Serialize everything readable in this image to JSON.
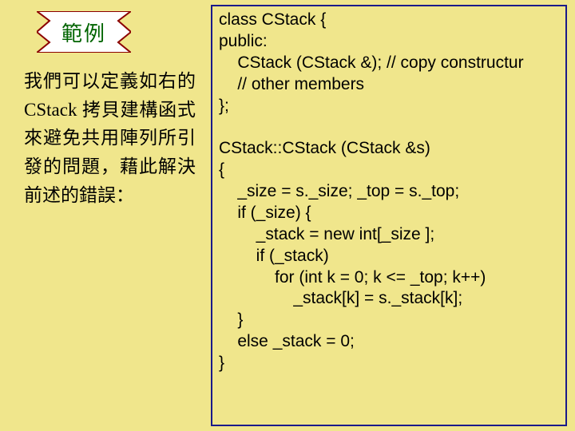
{
  "banner": {
    "label": "範例"
  },
  "description": "我們可以定義如右的 CStack 拷貝建構函式來避免共用陣列所引發的問題，藉此解決前述的錯誤：",
  "code": "class CStack {\npublic:\n    CStack (CStack &); // copy constructur\n    // other members\n};\n\nCStack::CStack (CStack &s)\n{\n    _size = s._size; _top = s._top;\n    if (_size) {\n        _stack = new int[_size ];\n        if (_stack)\n            for (int k = 0; k <= _top; k++)\n                _stack[k] = s._stack[k];\n    }\n    else _stack = 0;\n}"
}
